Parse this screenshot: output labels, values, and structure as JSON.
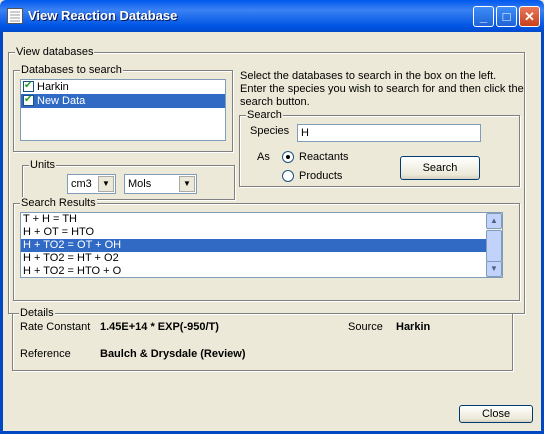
{
  "window": {
    "title": "View Reaction Database",
    "buttons": {
      "minimize": "_",
      "maximize": "□",
      "close": "✕"
    }
  },
  "view_databases": {
    "label": "View databases",
    "databases_group": {
      "label": "Databases to search",
      "items": [
        {
          "label": "Harkin",
          "checked": true,
          "selected": false
        },
        {
          "label": "New Data",
          "checked": true,
          "selected": true
        }
      ]
    },
    "units_group": {
      "label": "Units",
      "volume": "cm3",
      "amount": "Mols"
    },
    "instructions": "Select the databases to search in the box on the left. Enter the species you wish to search for and then click the search button.",
    "search_group": {
      "label": "Search",
      "species_label": "Species",
      "species_value": "H",
      "as_label": "As",
      "reactants_label": "Reactants",
      "products_label": "Products",
      "selected": "Reactants",
      "search_button": "Search"
    },
    "results_group": {
      "label": "Search Results",
      "rows": [
        {
          "text": "T + H = TH",
          "selected": false
        },
        {
          "text": "H + OT = HTO",
          "selected": false
        },
        {
          "text": "H + TO2 = OT + OH",
          "selected": true
        },
        {
          "text": "H + TO2 = HT + O2",
          "selected": false
        },
        {
          "text": "H + TO2 = HTO + O",
          "selected": false
        }
      ]
    },
    "details_group": {
      "label": "Details",
      "rate_constant_label": "Rate Constant",
      "rate_constant_value": "1.45E+14 * EXP(-950/T)",
      "source_label": "Source",
      "source_value": "Harkin",
      "reference_label": "Reference",
      "reference_value": "Baulch & Drysdale (Review)"
    }
  },
  "close_button": "Close",
  "colors": {
    "titlebar": "#0055e5",
    "selection": "#316ac5",
    "dialog_bg": "#ece9d8"
  }
}
